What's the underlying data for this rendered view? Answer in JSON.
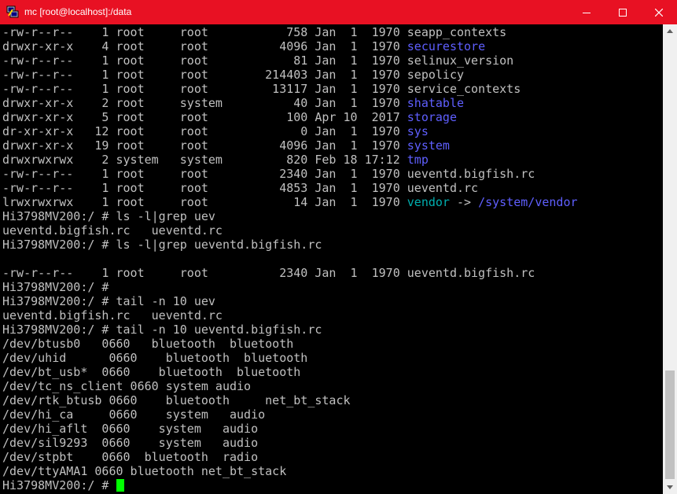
{
  "window": {
    "title": "mc [root@localhost]:/data"
  },
  "colors": {
    "text": "#c0c0c0",
    "dir": "#5f5fff",
    "link": "#00afaf",
    "cursor": "#00ff00",
    "titlebar": "#e81123"
  },
  "terminal": {
    "lines": [
      [
        {
          "t": "-rw-r--r--    1 root     root           758 Jan  1  1970 seapp_contexts"
        }
      ],
      [
        {
          "t": "drwxr-xr-x    4 root     root          4096 Jan  1  1970 "
        },
        {
          "t": "securestore",
          "c": "#5f5fff"
        }
      ],
      [
        {
          "t": "-rw-r--r--    1 root     root            81 Jan  1  1970 selinux_version"
        }
      ],
      [
        {
          "t": "-rw-r--r--    1 root     root        214403 Jan  1  1970 sepolicy"
        }
      ],
      [
        {
          "t": "-rw-r--r--    1 root     root         13117 Jan  1  1970 service_contexts"
        }
      ],
      [
        {
          "t": "drwxr-xr-x    2 root     system          40 Jan  1  1970 "
        },
        {
          "t": "shatable",
          "c": "#5f5fff"
        }
      ],
      [
        {
          "t": "drwxr-xr-x    5 root     root           100 Apr 10  2017 "
        },
        {
          "t": "storage",
          "c": "#5f5fff"
        }
      ],
      [
        {
          "t": "dr-xr-xr-x   12 root     root             0 Jan  1  1970 "
        },
        {
          "t": "sys",
          "c": "#5f5fff"
        }
      ],
      [
        {
          "t": "drwxr-xr-x   19 root     root          4096 Jan  1  1970 "
        },
        {
          "t": "system",
          "c": "#5f5fff"
        }
      ],
      [
        {
          "t": "drwxrwxrwx    2 system   system         820 Feb 18 17:12 "
        },
        {
          "t": "tmp",
          "c": "#5f5fff"
        }
      ],
      [
        {
          "t": "-rw-r--r--    1 root     root          2340 Jan  1  1970 ueventd.bigfish.rc"
        }
      ],
      [
        {
          "t": "-rw-r--r--    1 root     root          4853 Jan  1  1970 ueventd.rc"
        }
      ],
      [
        {
          "t": "lrwxrwxrwx    1 root     root            14 Jan  1  1970 "
        },
        {
          "t": "vendor",
          "c": "#00afaf"
        },
        {
          "t": " -> "
        },
        {
          "t": "/system/vendor",
          "c": "#5f5fff"
        }
      ],
      [
        {
          "t": "Hi3798MV200:/ # ls -l|grep uev"
        }
      ],
      [
        {
          "t": "ueventd.bigfish.rc   ueventd.rc"
        }
      ],
      [
        {
          "t": "Hi3798MV200:/ # ls -l|grep ueventd.bigfish.rc"
        }
      ],
      [
        {
          "t": ""
        }
      ],
      [
        {
          "t": "-rw-r--r--    1 root     root          2340 Jan  1  1970 ueventd.bigfish.rc"
        }
      ],
      [
        {
          "t": "Hi3798MV200:/ #"
        }
      ],
      [
        {
          "t": "Hi3798MV200:/ # tail -n 10 uev"
        }
      ],
      [
        {
          "t": "ueventd.bigfish.rc   ueventd.rc"
        }
      ],
      [
        {
          "t": "Hi3798MV200:/ # tail -n 10 ueventd.bigfish.rc"
        }
      ],
      [
        {
          "t": "/dev/btusb0   0660   bluetooth  bluetooth"
        }
      ],
      [
        {
          "t": "/dev/uhid      0660    bluetooth  bluetooth"
        }
      ],
      [
        {
          "t": "/dev/bt_usb*  0660    bluetooth  bluetooth"
        }
      ],
      [
        {
          "t": "/dev/tc_ns_client 0660 system audio"
        }
      ],
      [
        {
          "t": "/dev/rtk_btusb 0660    bluetooth     net_bt_stack"
        }
      ],
      [
        {
          "t": "/dev/hi_ca     0660    system   audio"
        }
      ],
      [
        {
          "t": "/dev/hi_aflt  0660    system   audio"
        }
      ],
      [
        {
          "t": "/dev/sil9293  0660    system   audio"
        }
      ],
      [
        {
          "t": "/dev/stpbt    0660  bluetooth  radio"
        }
      ],
      [
        {
          "t": "/dev/ttyAMA1 0660 bluetooth net_bt_stack"
        }
      ],
      [
        {
          "t": "Hi3798MV200:/ # "
        }
      ]
    ]
  }
}
